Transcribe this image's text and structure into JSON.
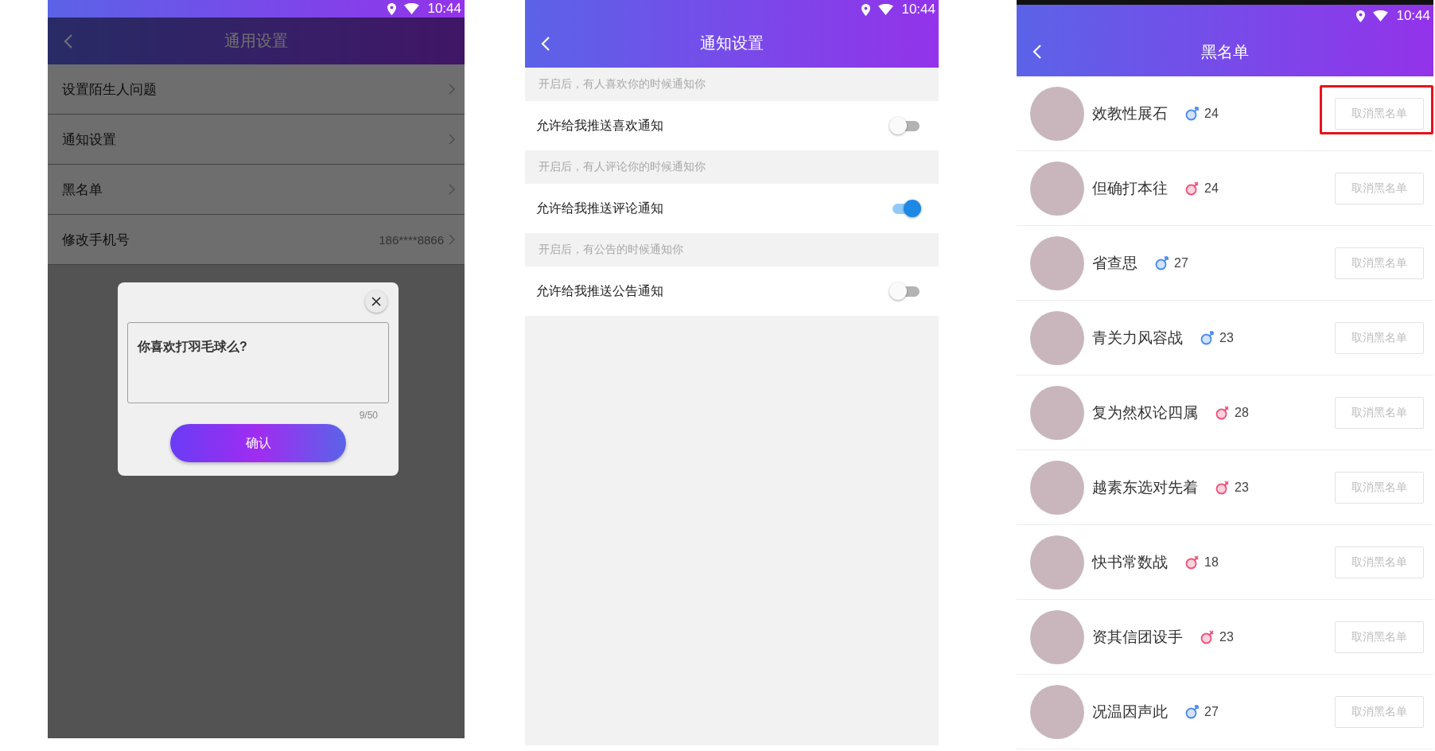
{
  "general_settings": {
    "status_time": "10:44",
    "title": "通用设置",
    "items": [
      {
        "label": "设置陌生人问题"
      },
      {
        "label": "通知设置"
      },
      {
        "label": "黑名单"
      },
      {
        "label": "修改手机号",
        "value": "186****8866"
      }
    ],
    "dialog": {
      "question": "你喜欢打羽毛球么?",
      "counter": "9/50",
      "confirm": "确认"
    }
  },
  "notification_settings": {
    "status_time": "10:44",
    "title": "通知设置",
    "sections": [
      {
        "hint": "开启后，有人喜欢你的时候通知你",
        "label": "允许给我推送喜欢通知",
        "on": false
      },
      {
        "hint": "开启后，有人评论你的时候通知你",
        "label": "允许给我推送评论通知",
        "on": true
      },
      {
        "hint": "开启后，有公告的时候通知你",
        "label": "允许给我推送公告通知",
        "on": false
      }
    ]
  },
  "blacklist": {
    "status_time": "10:44",
    "title": "黑名单",
    "rows": [
      {
        "name": "效教性展石",
        "kind": "male",
        "age": "24",
        "button": "取消黑名单",
        "highlighted": true
      },
      {
        "name": "但确打本往",
        "kind": "female",
        "age": "24",
        "button": "取消黑名单",
        "highlighted": false
      },
      {
        "name": "省查思",
        "kind": "male",
        "age": "27",
        "button": "取消黑名单",
        "highlighted": false
      },
      {
        "name": "青关力风容战",
        "kind": "male",
        "age": "23",
        "button": "取消黑名单",
        "highlighted": false
      },
      {
        "name": "复为然权论四属",
        "kind": "female",
        "age": "28",
        "button": "取消黑名单",
        "highlighted": false
      },
      {
        "name": "越素东选对先着",
        "kind": "female",
        "age": "23",
        "button": "取消黑名单",
        "highlighted": false
      },
      {
        "name": "快书常数战",
        "kind": "female",
        "age": "18",
        "button": "取消黑名单",
        "highlighted": false
      },
      {
        "name": "资其信团设手",
        "kind": "female",
        "age": "23",
        "button": "取消黑名单",
        "highlighted": false
      },
      {
        "name": "况温因声此",
        "kind": "male",
        "age": "27",
        "button": "取消黑名单",
        "highlighted": false
      }
    ]
  }
}
